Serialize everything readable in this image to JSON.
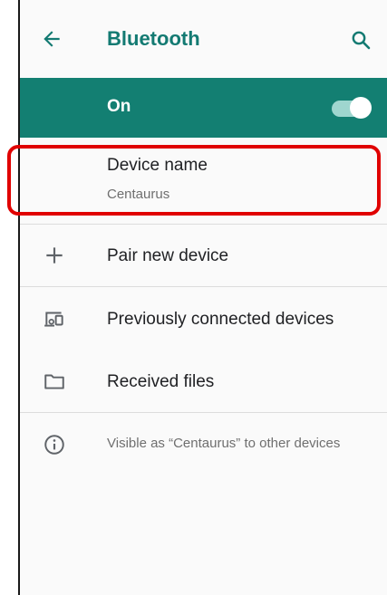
{
  "app_bar": {
    "title": "Bluetooth",
    "back_icon": "arrow-left-icon",
    "search_icon": "search-icon"
  },
  "master_switch": {
    "label": "On",
    "state": "on",
    "accent": "#137f72"
  },
  "device_name": {
    "title": "Device name",
    "value": "Centaurus"
  },
  "items": [
    {
      "label": "Pair new device",
      "icon": "plus-icon"
    },
    {
      "label": "Previously connected devices",
      "icon": "devices-icon"
    },
    {
      "label": "Received files",
      "icon": "folder-icon"
    }
  ],
  "footer": {
    "text": "Visible as “Centaurus” to other devices",
    "icon": "info-icon"
  },
  "highlight_color": "#e00000"
}
